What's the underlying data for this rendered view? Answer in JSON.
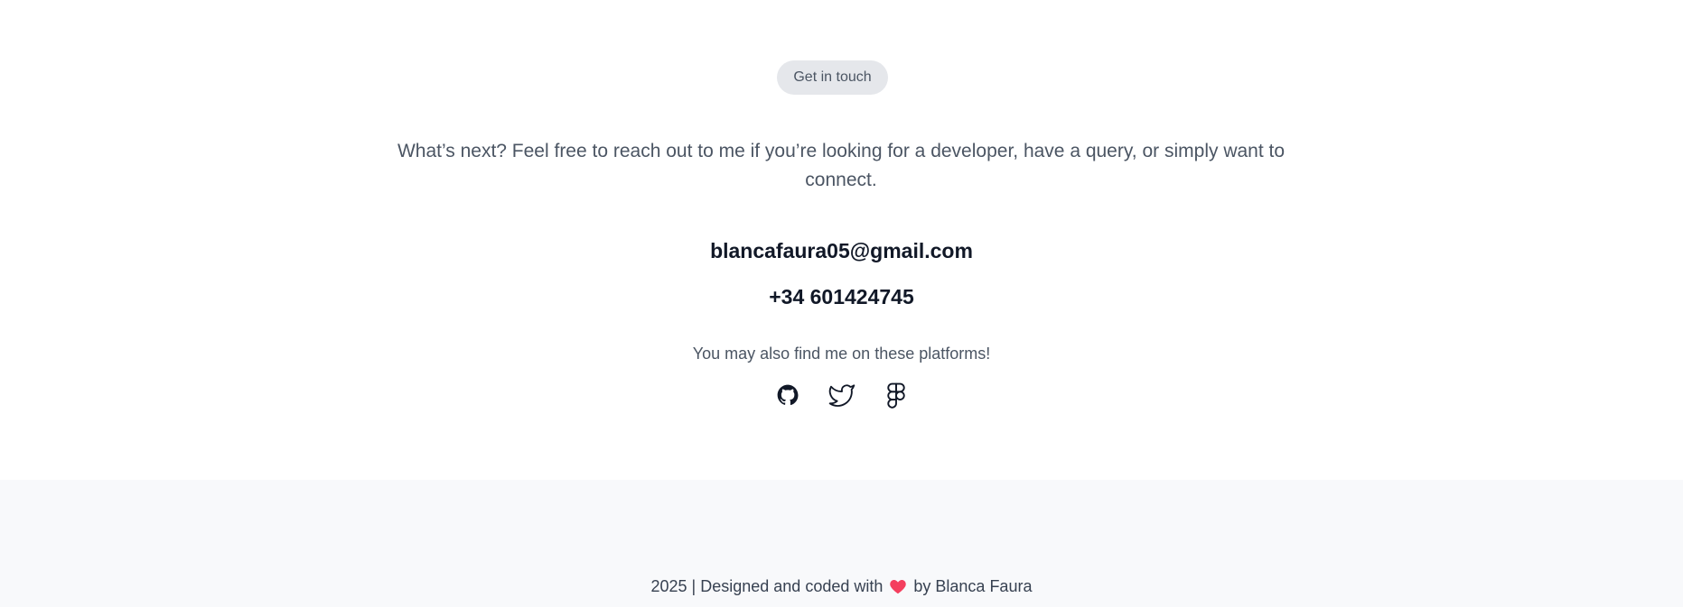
{
  "contact": {
    "badge": "Get in touch",
    "intro": "What’s next? Feel free to reach out to me if you’re looking for a developer, have a query, or simply want to connect.",
    "email": "blancafaura05@gmail.com",
    "phone": "+34 601424745",
    "platforms_text": "You may also find me on these platforms!",
    "socials": [
      {
        "icon": "github-icon"
      },
      {
        "icon": "twitter-icon"
      },
      {
        "icon": "figma-icon"
      }
    ]
  },
  "footer": {
    "text_before": "2025 | Designed and coded with",
    "heart_icon": "heart-icon",
    "heart_color": "#f43f5e",
    "text_after": "by Blanca Faura"
  }
}
